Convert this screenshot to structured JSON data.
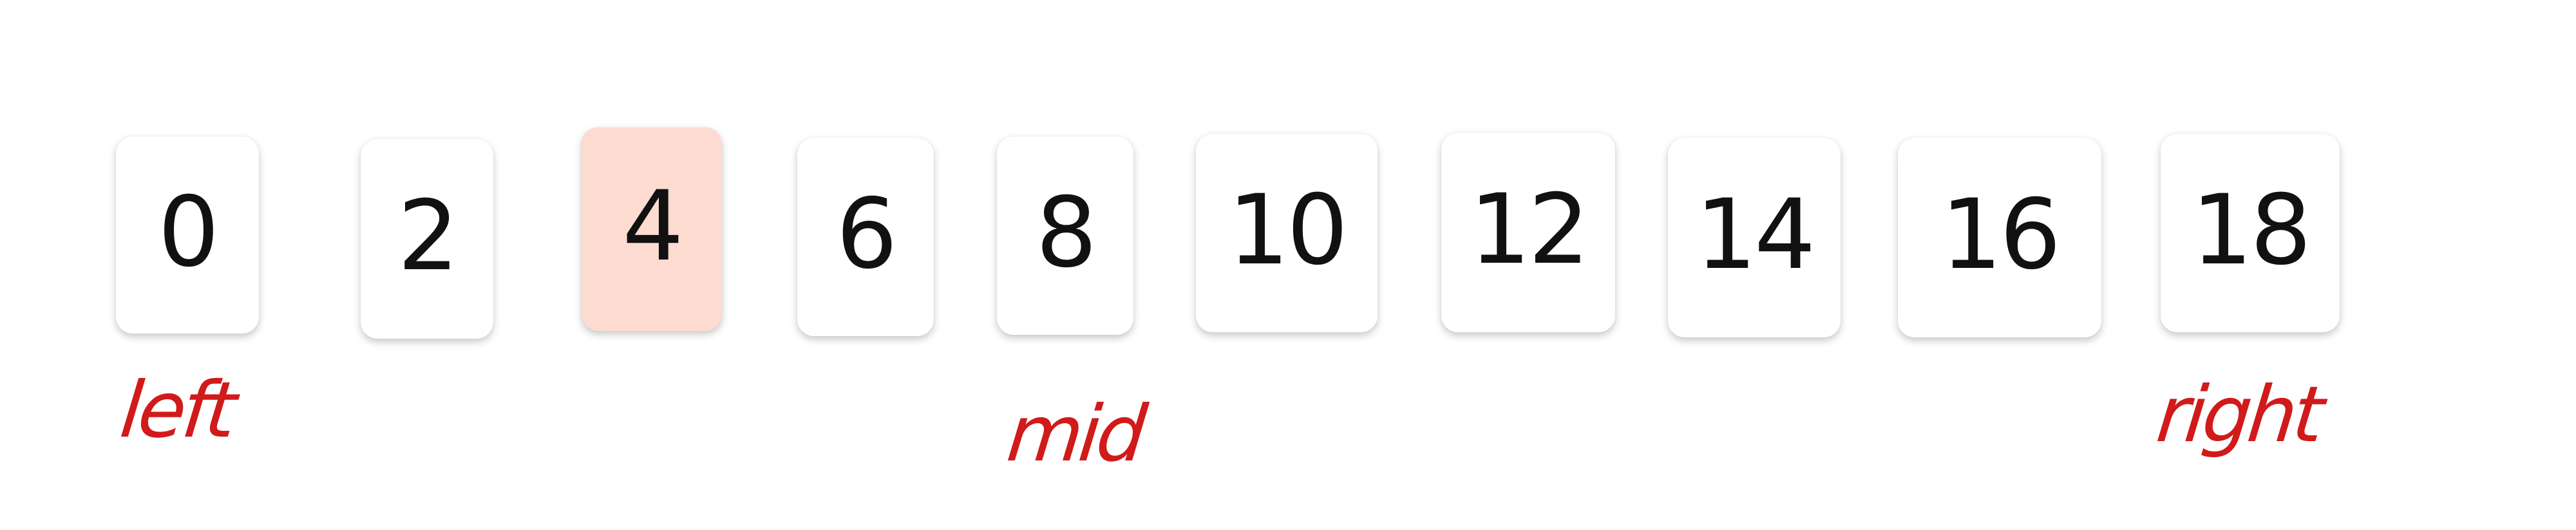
{
  "array": {
    "values": [
      "0",
      "2",
      "4",
      "6",
      "8",
      "10",
      "12",
      "14",
      "16",
      "18"
    ],
    "highlighted_index": 2,
    "highlight_color": "#fddbd1"
  },
  "pointers": {
    "left": "left",
    "mid": "mid",
    "right": "right",
    "color": "#d11a1a"
  }
}
